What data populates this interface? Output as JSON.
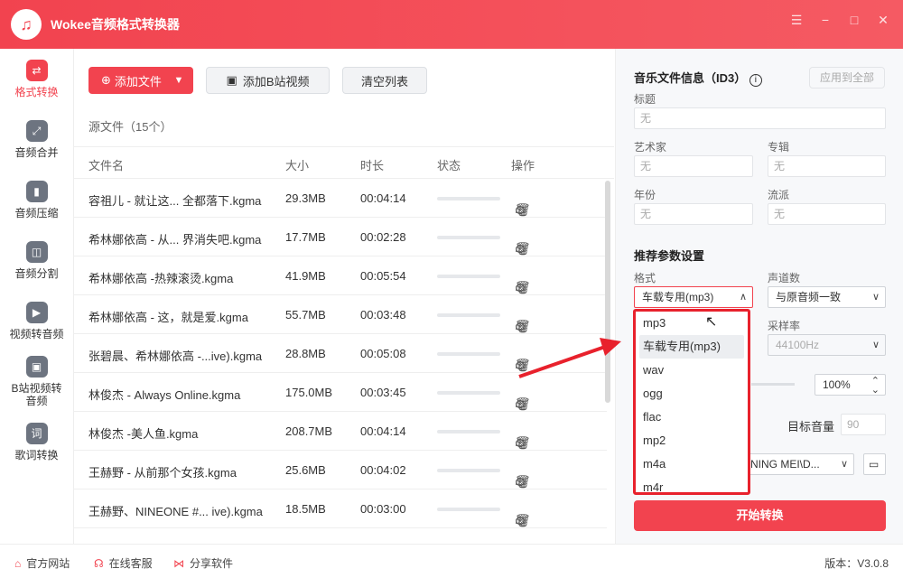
{
  "app": {
    "title": "Wokee音频格式转换器"
  },
  "window": {
    "min": "−",
    "skin": "☰",
    "max": "□",
    "close": "✕"
  },
  "sidebar": {
    "items": [
      {
        "label": "格式转换",
        "active": true
      },
      {
        "label": "音频合并"
      },
      {
        "label": "音频压缩"
      },
      {
        "label": "音频分割"
      },
      {
        "label": "视频转音频"
      },
      {
        "label": "B站视频转音频"
      },
      {
        "label": "歌词转换"
      }
    ]
  },
  "toolbar": {
    "add_file": "添加文件",
    "add_bilibili": "添加B站视频",
    "clear_list": "清空列表"
  },
  "file_list": {
    "count_label": "源文件（15个）",
    "headers": {
      "name": "文件名",
      "size": "大小",
      "duration": "时长",
      "status": "状态",
      "ops": "操作"
    },
    "rows": [
      {
        "name": "容祖儿 - 就让这... 全都落下.kgma",
        "size": "29.3MB",
        "duration": "00:04:14"
      },
      {
        "name": "希林娜依高 - 从... 界消失吧.kgma",
        "size": "17.7MB",
        "duration": "00:02:28"
      },
      {
        "name": "希林娜依高 -热辣滚烫.kgma",
        "size": "41.9MB",
        "duration": "00:05:54"
      },
      {
        "name": "希林娜依高 - 这，就是爱.kgma",
        "size": "55.7MB",
        "duration": "00:03:48"
      },
      {
        "name": "张碧晨、希林娜依高 -...ive).kgma",
        "size": "28.8MB",
        "duration": "00:05:08"
      },
      {
        "name": "林俊杰 - Always Online.kgma",
        "size": "175.0MB",
        "duration": "00:03:45"
      },
      {
        "name": "林俊杰 -美人鱼.kgma",
        "size": "208.7MB",
        "duration": "00:04:14"
      },
      {
        "name": "王赫野 - 从前那个女孩.kgma",
        "size": "25.6MB",
        "duration": "00:04:02"
      },
      {
        "name": "王赫野、NINEONE #... ive).kgma",
        "size": "18.5MB",
        "duration": "00:03:00"
      }
    ]
  },
  "id3": {
    "title": "音乐文件信息（ID3）",
    "apply_all": "应用到全部",
    "fields": {
      "title_label": "标题",
      "artist_label": "艺术家",
      "album_label": "专辑",
      "year_label": "年份",
      "genre_label": "流派",
      "empty": "无"
    }
  },
  "params": {
    "title": "推荐参数设置",
    "format_label": "格式",
    "format_value": "车载专用(mp3)",
    "channels_label": "声道数",
    "channels_value": "与原音频一致",
    "samplerate_label": "采样率",
    "samplerate_value": "44100Hz",
    "volume_value": "100%",
    "target_volume_label": "目标音量",
    "target_volume_value": "90",
    "output_path": "NING MEI\\D..."
  },
  "format_options": [
    "mp3",
    "车载专用(mp3)",
    "wav",
    "ogg",
    "flac",
    "mp2",
    "m4a",
    "m4r"
  ],
  "start_button": "开始转换",
  "footer": {
    "website": "官方网站",
    "support": "在线客服",
    "share": "分享软件",
    "version": "版本：V3.0.8"
  }
}
